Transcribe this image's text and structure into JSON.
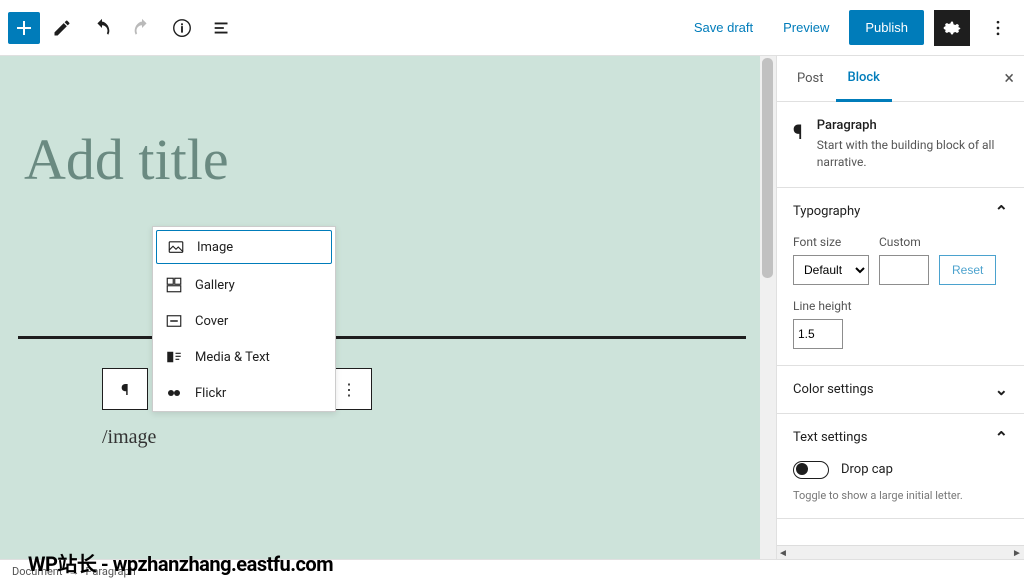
{
  "toolbar": {
    "save_draft": "Save draft",
    "preview": "Preview",
    "publish": "Publish"
  },
  "canvas": {
    "title_placeholder": "Add title",
    "slash_input": "/image"
  },
  "autocomplete": {
    "items": [
      {
        "label": "Image",
        "icon": "image"
      },
      {
        "label": "Gallery",
        "icon": "gallery"
      },
      {
        "label": "Cover",
        "icon": "cover"
      },
      {
        "label": "Media & Text",
        "icon": "media-text"
      },
      {
        "label": "Flickr",
        "icon": "flickr"
      }
    ]
  },
  "sidebar": {
    "tabs": {
      "post": "Post",
      "block": "Block"
    },
    "block_header": {
      "title": "Paragraph",
      "description": "Start with the building block of all narrative."
    },
    "typography": {
      "panel_title": "Typography",
      "font_size_label": "Font size",
      "font_size_value": "Default",
      "custom_label": "Custom",
      "custom_value": "",
      "reset": "Reset",
      "line_height_label": "Line height",
      "line_height_value": "1.5"
    },
    "color_panel": {
      "title": "Color settings"
    },
    "text_panel": {
      "title": "Text settings",
      "drop_cap_label": "Drop cap",
      "drop_cap_desc": "Toggle to show a large initial letter."
    }
  },
  "breadcrumb": {
    "doc": "Document",
    "sep": "→",
    "leaf": "Paragraph"
  },
  "watermark": "WP站长 - wpzhanzhang.eastfu.com"
}
